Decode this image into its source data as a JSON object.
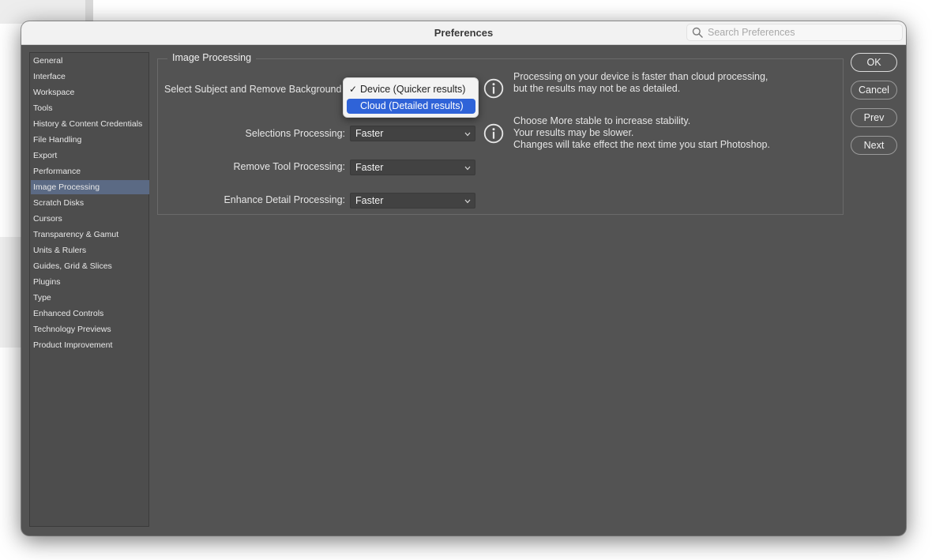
{
  "window": {
    "title": "Preferences"
  },
  "search": {
    "placeholder": "Search Preferences"
  },
  "sidebar": {
    "items": [
      {
        "label": "General"
      },
      {
        "label": "Interface"
      },
      {
        "label": "Workspace"
      },
      {
        "label": "Tools"
      },
      {
        "label": "History & Content Credentials"
      },
      {
        "label": "File Handling"
      },
      {
        "label": "Export"
      },
      {
        "label": "Performance"
      },
      {
        "label": "Image Processing",
        "selected": true
      },
      {
        "label": "Scratch Disks"
      },
      {
        "label": "Cursors"
      },
      {
        "label": "Transparency & Gamut"
      },
      {
        "label": "Units & Rulers"
      },
      {
        "label": "Guides, Grid & Slices"
      },
      {
        "label": "Plugins"
      },
      {
        "label": "Type"
      },
      {
        "label": "Enhanced Controls"
      },
      {
        "label": "Technology Previews"
      },
      {
        "label": "Product Improvement"
      }
    ]
  },
  "image_processing": {
    "title": "Image Processing",
    "select_subject": {
      "label": "Select Subject and Remove Background",
      "options": [
        {
          "check": "✓",
          "label": "Device (Quicker results)"
        },
        {
          "check": "",
          "label": "Cloud (Detailed results)"
        }
      ],
      "info": [
        "Processing on your device is faster than cloud processing,",
        "but the results may not be as detailed."
      ]
    },
    "selections": {
      "label": "Selections Processing:",
      "value": "Faster"
    },
    "remove_tool": {
      "label": "Remove Tool Processing:",
      "value": "Faster"
    },
    "enhance_detail": {
      "label": "Enhance Detail Processing:",
      "value": "Faster"
    },
    "stability_info": [
      "Choose More stable to increase stability.",
      "Your results may be slower.",
      "Changes will take effect the next time you start Photoshop."
    ]
  },
  "buttons": {
    "ok": "OK",
    "cancel": "Cancel",
    "prev": "Prev",
    "next": "Next"
  },
  "colors": {
    "dialog_bg": "#535353",
    "sidebar_selected": "#5b6a84",
    "menu_highlight": "#2f63d8"
  },
  "icons": [
    "search-icon",
    "info-icon",
    "chevron-down-icon",
    "checkmark-icon"
  ]
}
